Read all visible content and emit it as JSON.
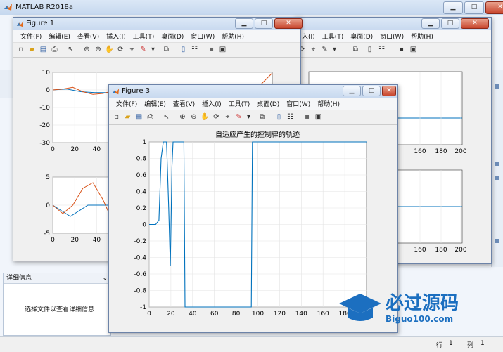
{
  "app": {
    "title": "MATLAB R2018a"
  },
  "menu": [
    "文件(F)",
    "编辑(E)",
    "查看(V)",
    "插入(I)",
    "工具(T)",
    "桌面(D)",
    "窗口(W)",
    "帮助(H)"
  ],
  "figure1": {
    "title": "Figure 1"
  },
  "figure2": {
    "menu_visible": [
      "入(I)",
      "工具(T)",
      "桌面(D)",
      "窗口(W)",
      "帮助(H)"
    ]
  },
  "figure3": {
    "title": "Figure 3"
  },
  "details": {
    "header": "详细信息",
    "message": "选择文件以查看详细信息"
  },
  "status": {
    "row_label": "行",
    "row_value": "1",
    "col_label": "列",
    "col_value": "1"
  },
  "watermark": {
    "brand": "必过源码",
    "url": "Biguo100.com"
  },
  "colors": {
    "blue": "#0072bd",
    "orange": "#d95319"
  },
  "chart_data": [
    {
      "type": "line",
      "title": "自适应产生的控制律的轨迹",
      "x": [
        0,
        6,
        9,
        11,
        13,
        16,
        17,
        18,
        19,
        19.5,
        20,
        21,
        22,
        23,
        32,
        33,
        94,
        95,
        200
      ],
      "series": [
        {
          "values": [
            0,
            0,
            0.05,
            0.8,
            1,
            1,
            0.6,
            0.2,
            -0.3,
            -0.5,
            -0.1,
            0.7,
            1,
            1,
            1,
            -1,
            -1,
            1,
            1
          ]
        }
      ],
      "xlim": [
        0,
        200
      ],
      "ylim": [
        -1,
        1
      ],
      "xticks": [
        "0",
        "20",
        "40",
        "60",
        "80",
        "100",
        "120",
        "140",
        "160",
        "180"
      ],
      "yticks": [
        "-1",
        "-0.8",
        "-0.6",
        "-0.4",
        "-0.2",
        "0",
        "0.2",
        "0.4",
        "0.6",
        "0.8",
        "1"
      ]
    },
    {
      "type": "line",
      "yticks": [
        "10",
        "0",
        "-10",
        "-20",
        "-30"
      ],
      "xticks": [
        "0",
        "20",
        "40"
      ],
      "series": [
        {
          "values": [
            0,
            0.5,
            -1,
            -1.5,
            -1.5,
            -1.2
          ]
        },
        {
          "values": [
            0,
            0.5,
            1.5,
            -1,
            -2.5,
            -2,
            -0.5,
            1
          ]
        }
      ],
      "ylim": [
        -30,
        10
      ]
    },
    {
      "type": "line",
      "yticks": [
        "5",
        "0",
        "-5"
      ],
      "xticks": [
        "0",
        "20",
        "40"
      ],
      "series": [
        {
          "values": [
            0,
            -2,
            0,
            0,
            0
          ]
        },
        {
          "values": [
            0,
            -1.5,
            0,
            3,
            4,
            1,
            -3,
            -4
          ]
        }
      ],
      "ylim": [
        -5,
        5
      ]
    },
    {
      "type": "line",
      "xticks": [
        "160",
        "180",
        "200"
      ]
    },
    {
      "type": "line",
      "xticks": [
        "160",
        "180",
        "200"
      ]
    }
  ]
}
